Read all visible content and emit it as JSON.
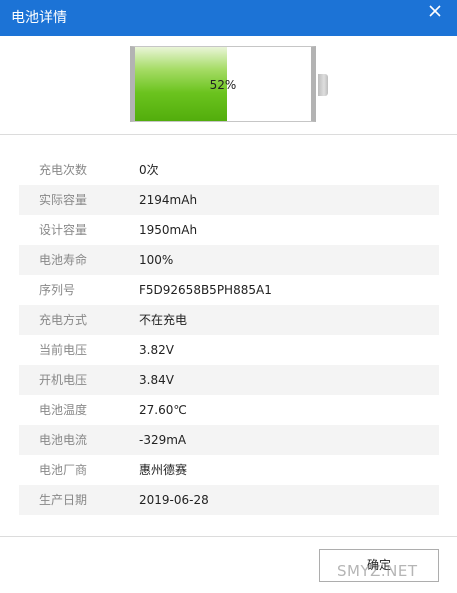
{
  "window": {
    "title": "电池详情"
  },
  "battery": {
    "percent_label": "52%",
    "level": 0.52
  },
  "details": [
    {
      "label": "充电次数",
      "value": "0次"
    },
    {
      "label": "实际容量",
      "value": "2194mAh"
    },
    {
      "label": "设计容量",
      "value": "1950mAh"
    },
    {
      "label": "电池寿命",
      "value": "100%"
    },
    {
      "label": "序列号",
      "value": "F5D92658B5PH885A1"
    },
    {
      "label": "充电方式",
      "value": "不在充电"
    },
    {
      "label": "当前电压",
      "value": "3.82V"
    },
    {
      "label": "开机电压",
      "value": "3.84V"
    },
    {
      "label": "电池温度",
      "value": "27.60℃"
    },
    {
      "label": "电池电流",
      "value": "-329mA"
    },
    {
      "label": "电池厂商",
      "value": "惠州德赛"
    },
    {
      "label": "生产日期",
      "value": "2019-06-28"
    }
  ],
  "footer": {
    "ok_label": "确定"
  },
  "watermark": "SMYZ.NET",
  "colors": {
    "titlebar": "#1c73d6",
    "battery_fill": "#6bc31e"
  }
}
